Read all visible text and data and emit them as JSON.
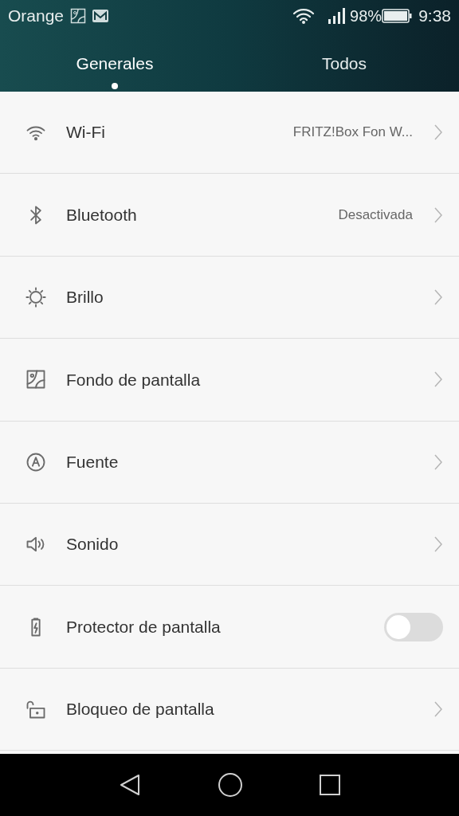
{
  "status_bar": {
    "carrier": "Orange",
    "battery": "98%",
    "time": "9:38"
  },
  "tabs": [
    {
      "label": "Generales",
      "selected": true
    },
    {
      "label": "Todos",
      "selected": false
    }
  ],
  "settings": [
    {
      "kind": "link",
      "label": "Wi-Fi",
      "value": "FRITZ!Box Fon W..."
    },
    {
      "kind": "link",
      "label": "Bluetooth",
      "value": "Desactivada"
    },
    {
      "kind": "link",
      "label": "Brillo"
    },
    {
      "kind": "link",
      "label": "Fondo de pantalla"
    },
    {
      "kind": "link",
      "label": "Fuente"
    },
    {
      "kind": "link",
      "label": "Sonido"
    },
    {
      "kind": "switch",
      "label": "Protector de pantalla",
      "on": false
    },
    {
      "kind": "link",
      "label": "Bloqueo de pantalla"
    }
  ]
}
